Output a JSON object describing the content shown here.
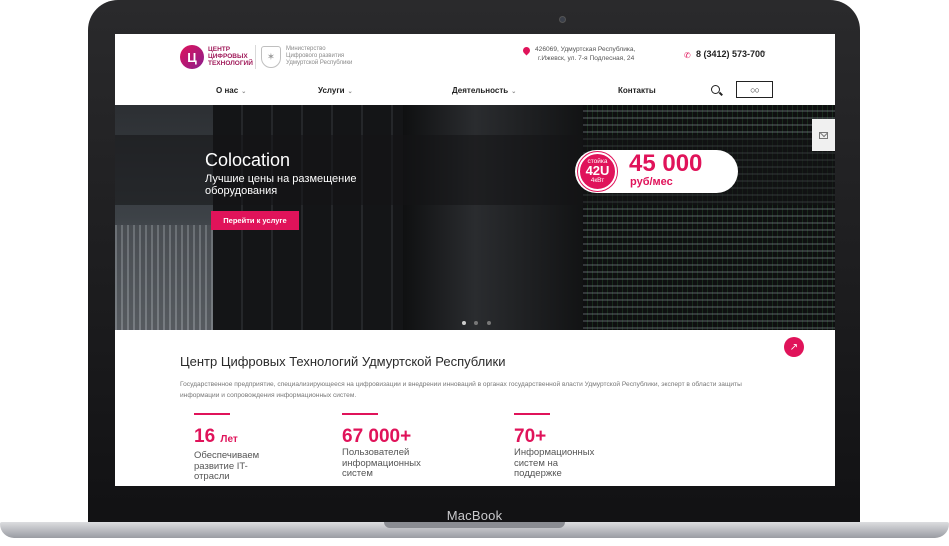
{
  "device": {
    "brand": "MacBook"
  },
  "header": {
    "logo": {
      "mark": "Ц",
      "lines": [
        "ЦЕНТР",
        "ЦИФРОВЫХ",
        "ТЕХНОЛОГИЙ"
      ]
    },
    "ministry": {
      "lines": [
        "Министерство",
        "Цифрового развития",
        "Удмуртской Республики"
      ]
    },
    "address": {
      "line1": "426069, Удмуртская Республика,",
      "line2": "г.Ижевск, ул. 7-я Подлесная, 24"
    },
    "phone": "8 (3412) 573-700"
  },
  "nav": {
    "items": [
      {
        "label": "О нас",
        "has_caret": true
      },
      {
        "label": "Услуги",
        "has_caret": true
      },
      {
        "label": "Деятельность",
        "has_caret": true
      },
      {
        "label": "Контакты",
        "has_caret": false
      }
    ],
    "icons": [
      "search-icon",
      "glasses-icon"
    ]
  },
  "hero": {
    "title": "Colocation",
    "subtitle": "Лучшие цены на размещение оборудования",
    "button": "Перейти к услуге",
    "badge": {
      "rack_label": "стойка",
      "rack_size": "42U",
      "rack_power": "4кВт",
      "price": "45 000",
      "unit": "руб/мес"
    },
    "slides": 3,
    "active_slide": 1
  },
  "about": {
    "title": "Центр Цифровых Технологий Удмуртской Республики",
    "text": "Государственное предприятие, специализирующееся на цифровизации и внедрении инноваций в органах государственной власти Удмуртской Республики, эксперт в области защиты информации и сопровождения информационных систем."
  },
  "stats": [
    {
      "value": "16",
      "unit": "Лет",
      "caption": "Обеспечиваем развитие IT-отрасли"
    },
    {
      "value": "67 000+",
      "unit": "",
      "caption": "Пользователей информационных систем"
    },
    {
      "value": "70+",
      "unit": "",
      "caption": "Информационных систем на поддержке"
    }
  ],
  "colors": {
    "accent": "#e0135a",
    "text": "#222222"
  }
}
